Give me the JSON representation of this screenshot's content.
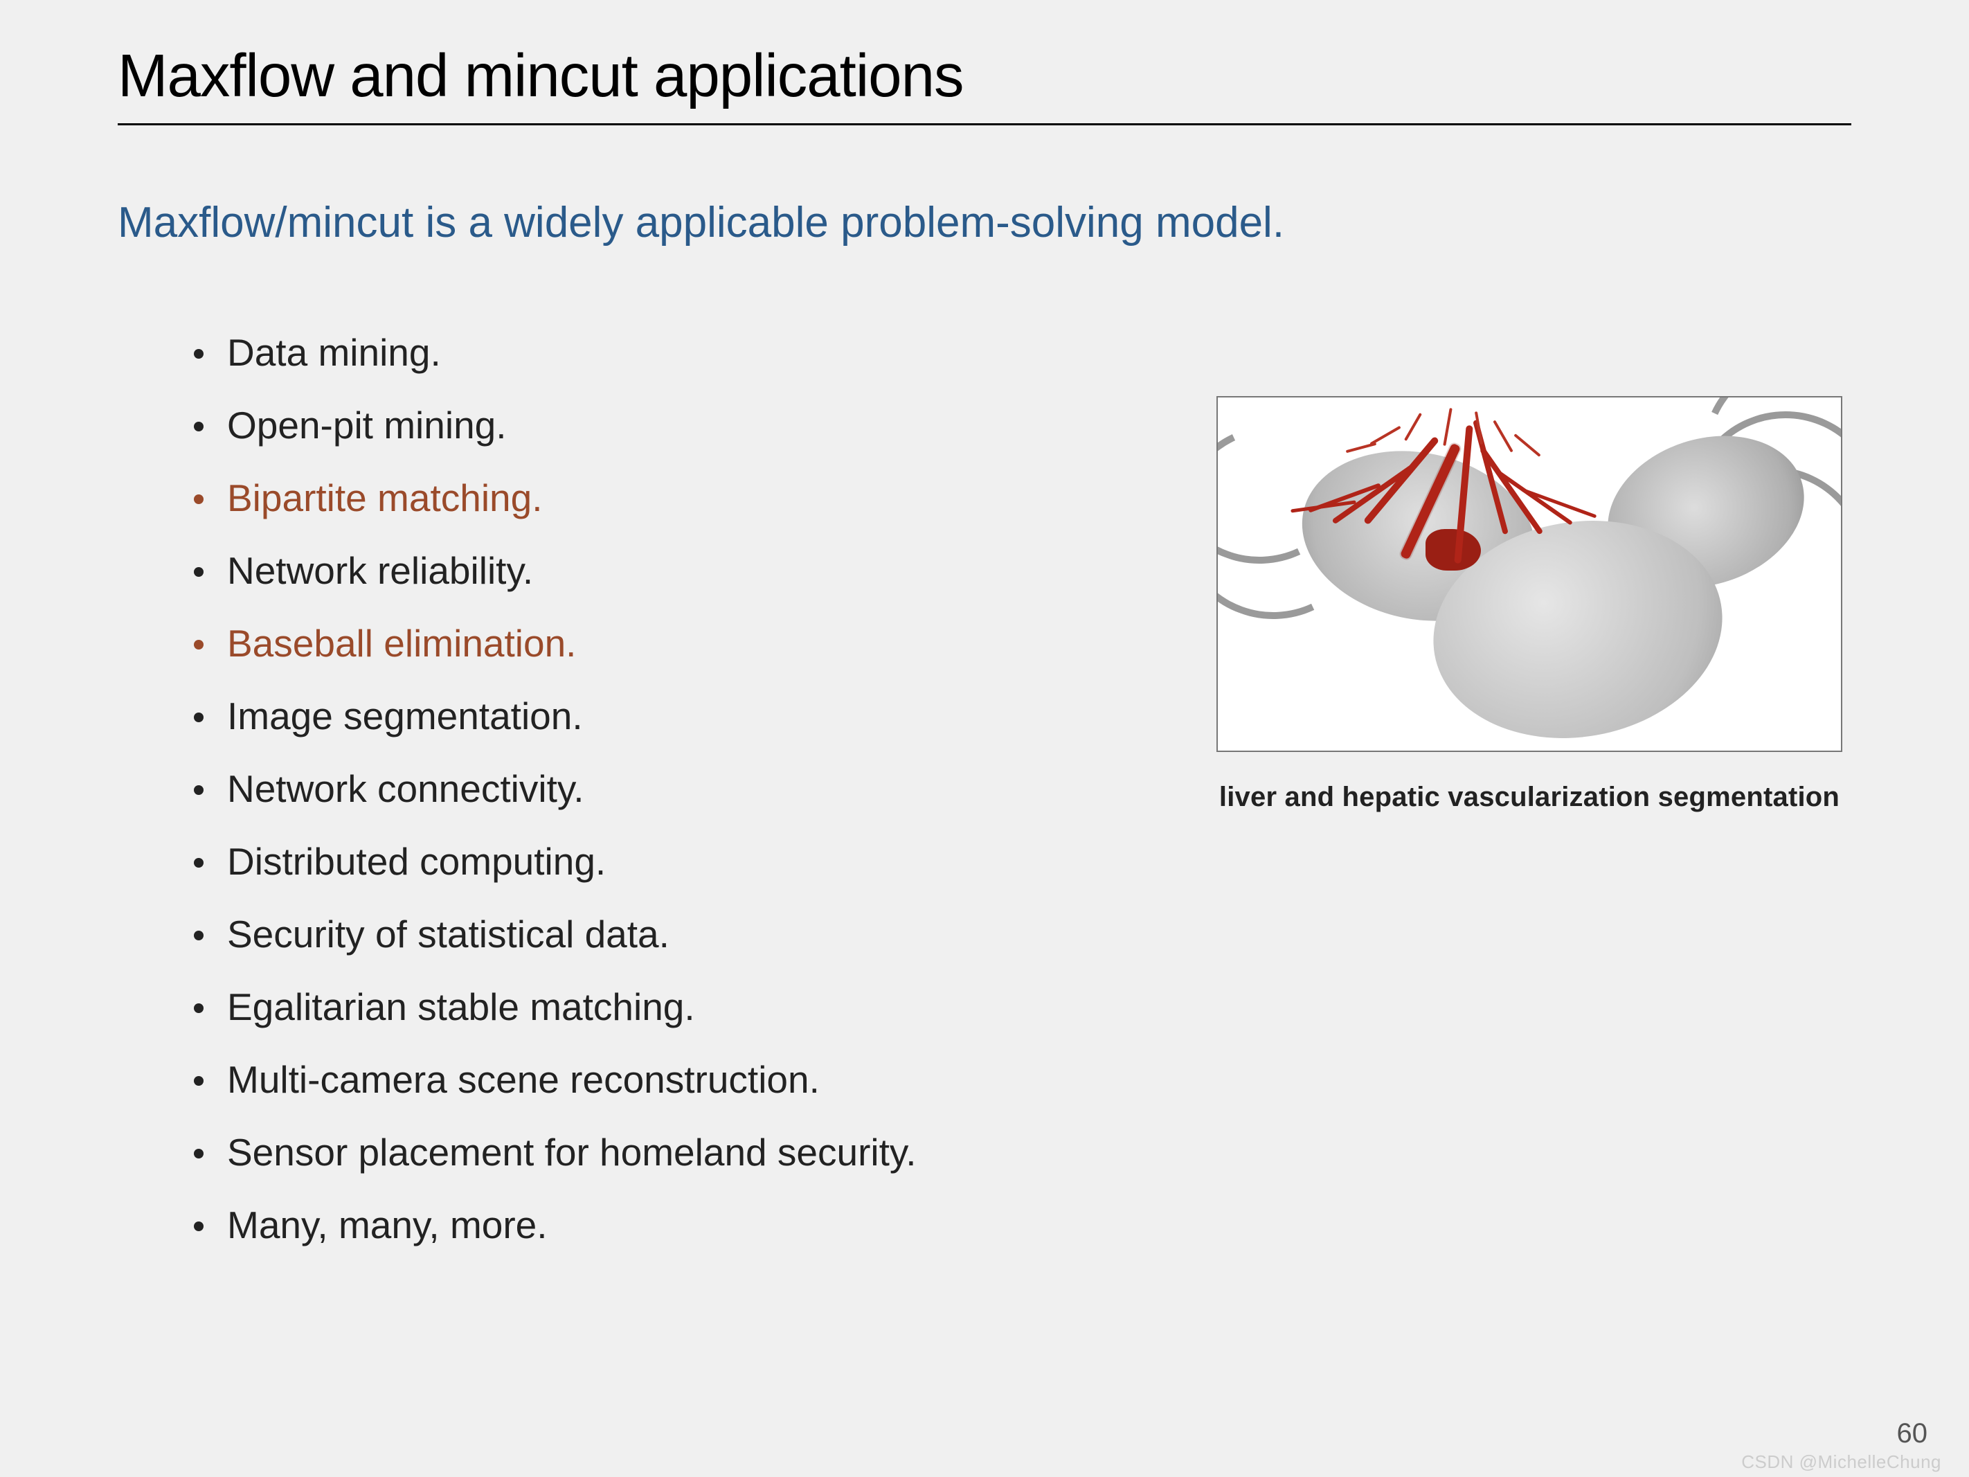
{
  "title": "Maxflow and mincut applications",
  "subtitle": "Maxflow/mincut is a widely applicable problem-solving model.",
  "bullets": [
    {
      "text": "Data mining.",
      "highlight": false
    },
    {
      "text": "Open-pit mining.",
      "highlight": false
    },
    {
      "text": "Bipartite matching.",
      "highlight": true
    },
    {
      "text": "Network reliability.",
      "highlight": false
    },
    {
      "text": "Baseball elimination.",
      "highlight": true
    },
    {
      "text": "Image segmentation.",
      "highlight": false
    },
    {
      "text": "Network connectivity.",
      "highlight": false
    },
    {
      "text": "Distributed computing.",
      "highlight": false
    },
    {
      "text": "Security of statistical data.",
      "highlight": false
    },
    {
      "text": "Egalitarian stable matching.",
      "highlight": false
    },
    {
      "text": "Multi-camera scene reconstruction.",
      "highlight": false
    },
    {
      "text": "Sensor placement for homeland security.",
      "highlight": false
    },
    {
      "text": "Many, many, more.",
      "highlight": false
    }
  ],
  "figure": {
    "caption": "liver and hepatic vascularization segmentation"
  },
  "page_number": "60",
  "watermark": "CSDN @MichelleChung"
}
